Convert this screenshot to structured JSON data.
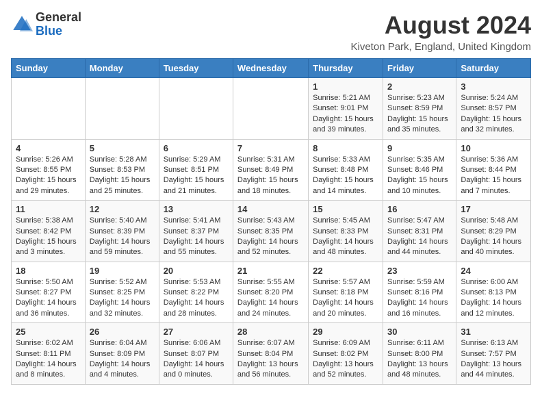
{
  "header": {
    "logo_general": "General",
    "logo_blue": "Blue",
    "month_year": "August 2024",
    "location": "Kiveton Park, England, United Kingdom"
  },
  "days_of_week": [
    "Sunday",
    "Monday",
    "Tuesday",
    "Wednesday",
    "Thursday",
    "Friday",
    "Saturday"
  ],
  "weeks": [
    [
      {
        "num": "",
        "info": ""
      },
      {
        "num": "",
        "info": ""
      },
      {
        "num": "",
        "info": ""
      },
      {
        "num": "",
        "info": ""
      },
      {
        "num": "1",
        "info": "Sunrise: 5:21 AM\nSunset: 9:01 PM\nDaylight: 15 hours and 39 minutes."
      },
      {
        "num": "2",
        "info": "Sunrise: 5:23 AM\nSunset: 8:59 PM\nDaylight: 15 hours and 35 minutes."
      },
      {
        "num": "3",
        "info": "Sunrise: 5:24 AM\nSunset: 8:57 PM\nDaylight: 15 hours and 32 minutes."
      }
    ],
    [
      {
        "num": "4",
        "info": "Sunrise: 5:26 AM\nSunset: 8:55 PM\nDaylight: 15 hours and 29 minutes."
      },
      {
        "num": "5",
        "info": "Sunrise: 5:28 AM\nSunset: 8:53 PM\nDaylight: 15 hours and 25 minutes."
      },
      {
        "num": "6",
        "info": "Sunrise: 5:29 AM\nSunset: 8:51 PM\nDaylight: 15 hours and 21 minutes."
      },
      {
        "num": "7",
        "info": "Sunrise: 5:31 AM\nSunset: 8:49 PM\nDaylight: 15 hours and 18 minutes."
      },
      {
        "num": "8",
        "info": "Sunrise: 5:33 AM\nSunset: 8:48 PM\nDaylight: 15 hours and 14 minutes."
      },
      {
        "num": "9",
        "info": "Sunrise: 5:35 AM\nSunset: 8:46 PM\nDaylight: 15 hours and 10 minutes."
      },
      {
        "num": "10",
        "info": "Sunrise: 5:36 AM\nSunset: 8:44 PM\nDaylight: 15 hours and 7 minutes."
      }
    ],
    [
      {
        "num": "11",
        "info": "Sunrise: 5:38 AM\nSunset: 8:42 PM\nDaylight: 15 hours and 3 minutes."
      },
      {
        "num": "12",
        "info": "Sunrise: 5:40 AM\nSunset: 8:39 PM\nDaylight: 14 hours and 59 minutes."
      },
      {
        "num": "13",
        "info": "Sunrise: 5:41 AM\nSunset: 8:37 PM\nDaylight: 14 hours and 55 minutes."
      },
      {
        "num": "14",
        "info": "Sunrise: 5:43 AM\nSunset: 8:35 PM\nDaylight: 14 hours and 52 minutes."
      },
      {
        "num": "15",
        "info": "Sunrise: 5:45 AM\nSunset: 8:33 PM\nDaylight: 14 hours and 48 minutes."
      },
      {
        "num": "16",
        "info": "Sunrise: 5:47 AM\nSunset: 8:31 PM\nDaylight: 14 hours and 44 minutes."
      },
      {
        "num": "17",
        "info": "Sunrise: 5:48 AM\nSunset: 8:29 PM\nDaylight: 14 hours and 40 minutes."
      }
    ],
    [
      {
        "num": "18",
        "info": "Sunrise: 5:50 AM\nSunset: 8:27 PM\nDaylight: 14 hours and 36 minutes."
      },
      {
        "num": "19",
        "info": "Sunrise: 5:52 AM\nSunset: 8:25 PM\nDaylight: 14 hours and 32 minutes."
      },
      {
        "num": "20",
        "info": "Sunrise: 5:53 AM\nSunset: 8:22 PM\nDaylight: 14 hours and 28 minutes."
      },
      {
        "num": "21",
        "info": "Sunrise: 5:55 AM\nSunset: 8:20 PM\nDaylight: 14 hours and 24 minutes."
      },
      {
        "num": "22",
        "info": "Sunrise: 5:57 AM\nSunset: 8:18 PM\nDaylight: 14 hours and 20 minutes."
      },
      {
        "num": "23",
        "info": "Sunrise: 5:59 AM\nSunset: 8:16 PM\nDaylight: 14 hours and 16 minutes."
      },
      {
        "num": "24",
        "info": "Sunrise: 6:00 AM\nSunset: 8:13 PM\nDaylight: 14 hours and 12 minutes."
      }
    ],
    [
      {
        "num": "25",
        "info": "Sunrise: 6:02 AM\nSunset: 8:11 PM\nDaylight: 14 hours and 8 minutes."
      },
      {
        "num": "26",
        "info": "Sunrise: 6:04 AM\nSunset: 8:09 PM\nDaylight: 14 hours and 4 minutes."
      },
      {
        "num": "27",
        "info": "Sunrise: 6:06 AM\nSunset: 8:07 PM\nDaylight: 14 hours and 0 minutes."
      },
      {
        "num": "28",
        "info": "Sunrise: 6:07 AM\nSunset: 8:04 PM\nDaylight: 13 hours and 56 minutes."
      },
      {
        "num": "29",
        "info": "Sunrise: 6:09 AM\nSunset: 8:02 PM\nDaylight: 13 hours and 52 minutes."
      },
      {
        "num": "30",
        "info": "Sunrise: 6:11 AM\nSunset: 8:00 PM\nDaylight: 13 hours and 48 minutes."
      },
      {
        "num": "31",
        "info": "Sunrise: 6:13 AM\nSunset: 7:57 PM\nDaylight: 13 hours and 44 minutes."
      }
    ]
  ]
}
